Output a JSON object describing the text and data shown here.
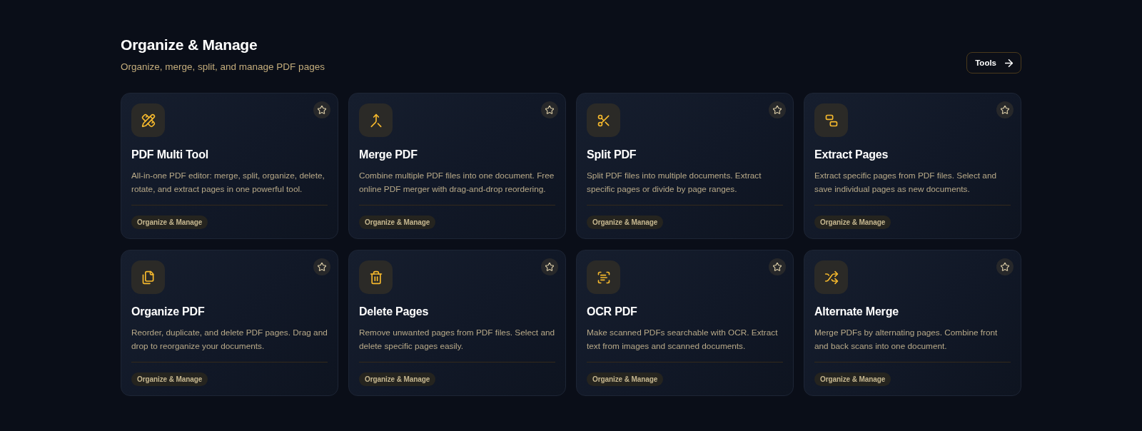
{
  "header": {
    "title": "Organize & Manage",
    "subtitle": "Organize, merge, split, and manage PDF pages",
    "button": {
      "label": "Tools"
    }
  },
  "tools": [
    {
      "title": "PDF Multi Tool",
      "description": "All-in-one PDF editor: merge, split, organize, delete, rotate, and extract pages in one powerful tool.",
      "category": "Organize & Manage",
      "favorite": false
    },
    {
      "title": "Merge PDF",
      "description": "Combine multiple PDF files into one document. Free online PDF merger with drag-and-drop reordering.",
      "category": "Organize & Manage",
      "favorite": false
    },
    {
      "title": "Split PDF",
      "description": "Split PDF files into multiple documents. Extract specific pages or divide by page ranges.",
      "category": "Organize & Manage",
      "favorite": false
    },
    {
      "title": "Extract Pages",
      "description": "Extract specific pages from PDF files. Select and save individual pages as new documents.",
      "category": "Organize & Manage",
      "favorite": false
    },
    {
      "title": "Organize PDF",
      "description": "Reorder, duplicate, and delete PDF pages. Drag and drop to reorganize your documents.",
      "category": "Organize & Manage",
      "favorite": false
    },
    {
      "title": "Delete Pages",
      "description": "Remove unwanted pages from PDF files. Select and delete specific pages easily.",
      "category": "Organize & Manage",
      "favorite": false
    },
    {
      "title": "OCR PDF",
      "description": "Make scanned PDFs searchable with OCR. Extract text from images and scanned documents.",
      "category": "Organize & Manage",
      "favorite": false
    },
    {
      "title": "Alternate Merge",
      "description": "Merge PDFs by alternating pages. Combine front and back scans into one document.",
      "category": "Organize & Manage",
      "favorite": false
    }
  ]
}
